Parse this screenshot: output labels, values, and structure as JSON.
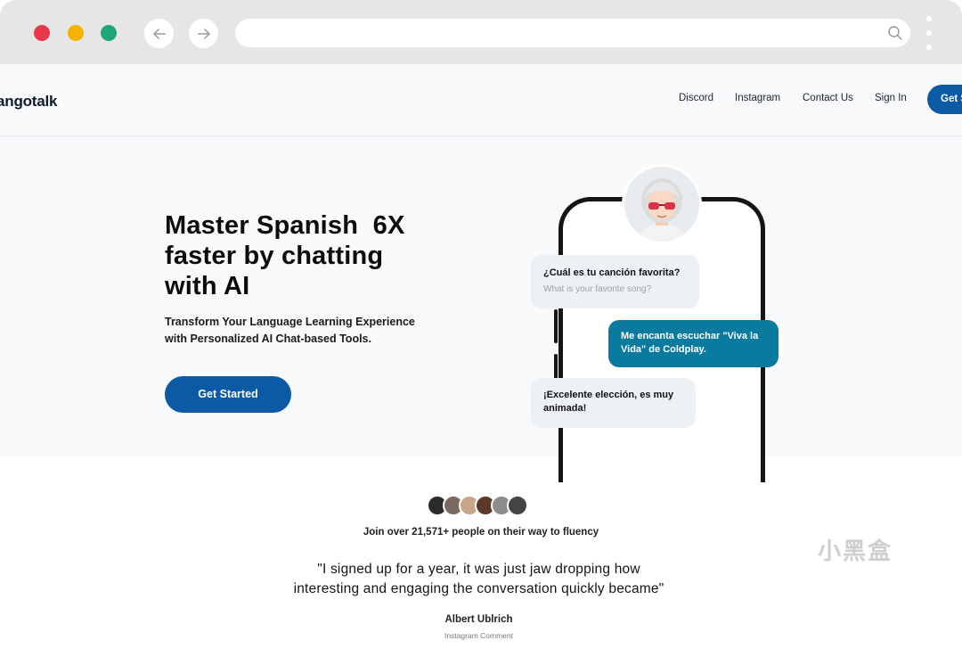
{
  "browser": {
    "url": ""
  },
  "header": {
    "logo": "angotalk",
    "nav": [
      "Discord",
      "Instagram",
      "Contact Us",
      "Sign In"
    ],
    "cta": "Get S"
  },
  "hero": {
    "headline": [
      "Master Spanish  6X",
      "faster by chatting",
      "with AI"
    ],
    "subtitle": [
      "Transform Your Language Learning Experience",
      "with Personalized AI Chat-based Tools."
    ],
    "cta": "Get Started"
  },
  "chat": {
    "question": "¿Cuál es tu canción favorita?",
    "translation": "What is your favorite song?",
    "reply": "Me encanta escuchar \"Viva la Vida\" de Coldplay.",
    "response": "¡Excelente elección, es muy animada!"
  },
  "social": {
    "join": "Join over 21,571+ people on their way to fluency",
    "quote": [
      "\"I signed up for a year, it was just jaw dropping how",
      "interesting and engaging the conversation quickly became\""
    ],
    "author": "Albert Ublrich",
    "source": "Instagram Comment"
  },
  "watermark": "小黑盒",
  "colors": {
    "primary": "#0b5aa5",
    "bubble_teal": "#0a7a9e",
    "close": "#e8394b",
    "minimize": "#f5b300",
    "maximize": "#1fa678"
  },
  "icons": {
    "back": "arrow-left-icon",
    "forward": "arrow-right-icon",
    "search": "search-icon",
    "menu": "kebab-menu-icon"
  }
}
